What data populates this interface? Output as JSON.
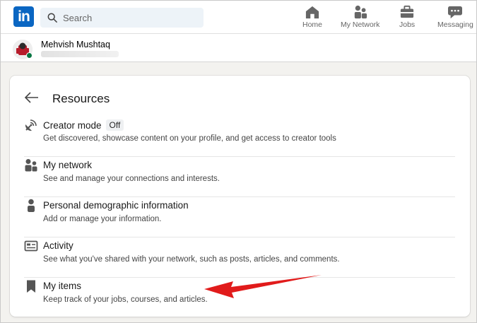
{
  "nav": {
    "logo_text": "in",
    "search_placeholder": "Search",
    "items": [
      {
        "label": "Home",
        "icon": "home-icon"
      },
      {
        "label": "My Network",
        "icon": "people-icon"
      },
      {
        "label": "Jobs",
        "icon": "briefcase-icon"
      },
      {
        "label": "Messaging",
        "icon": "chat-icon"
      }
    ]
  },
  "profile": {
    "name": "Mehvish Mushtaq"
  },
  "resources": {
    "title": "Resources",
    "items": [
      {
        "title": "Creator mode",
        "badge": "Off",
        "description": "Get discovered, showcase content on your profile, and get access to creator tools",
        "icon": "satellite-dish-icon"
      },
      {
        "title": "My network",
        "description": "See and manage your connections and interests.",
        "icon": "people-icon"
      },
      {
        "title": "Personal demographic information",
        "description": "Add or manage your information.",
        "icon": "person-icon"
      },
      {
        "title": "Activity",
        "description": "See what you've shared with your network, such as posts, articles, and comments.",
        "icon": "activity-icon"
      },
      {
        "title": "My items",
        "description": "Keep track of your jobs, courses, and articles.",
        "icon": "bookmark-icon"
      }
    ]
  },
  "colors": {
    "brand": "#0a66c2",
    "annotation_arrow": "#e11b1b",
    "presence": "#057642"
  }
}
